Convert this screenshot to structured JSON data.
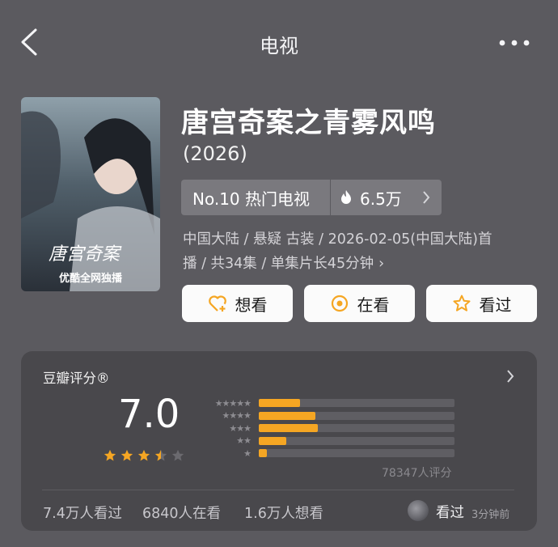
{
  "header": {
    "title": "电视"
  },
  "show": {
    "title": "唐宫奇案之青雾风鸣",
    "year": "(2026)",
    "poster": {
      "logo_text": "唐宫奇案",
      "caption": "优酷全网独播"
    },
    "rank": "No.10 热门电视",
    "heat": "6.5万",
    "meta_line1": "中国大陆 / 悬疑 古装 / 2026-02-05(中国大陆)首",
    "meta_line2": "播 / 共34集 / 单集片长45分钟",
    "meta_chevron": "›"
  },
  "actions": [
    {
      "label": "想看",
      "icon": "heart-plus-icon"
    },
    {
      "label": "在看",
      "icon": "target-circle-icon"
    },
    {
      "label": "看过",
      "icon": "star-outline-icon"
    }
  ],
  "rating": {
    "label": "豆瓣评分®",
    "score": "7.0",
    "stars_value": 3.5,
    "distribution": [
      {
        "stars": "★★★★★",
        "fraction": 0.21
      },
      {
        "stars": "★★★★",
        "fraction": 0.29
      },
      {
        "stars": "★★★",
        "fraction": 0.3
      },
      {
        "stars": "★★",
        "fraction": 0.14
      },
      {
        "stars": "★",
        "fraction": 0.04
      }
    ],
    "count": "78347人评分",
    "stats": [
      "7.4万人看过",
      "6840人在看",
      "1.6万人想看"
    ],
    "friend_action": "看过",
    "friend_time": "3分钟前"
  },
  "colors": {
    "accent": "#f5a623",
    "background": "#5b5a5f",
    "card": "#49484c"
  }
}
